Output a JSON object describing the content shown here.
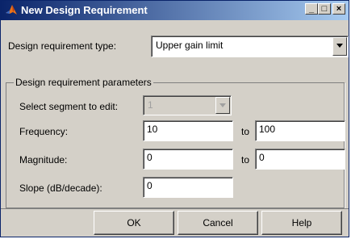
{
  "window": {
    "title": "New Design Requirement"
  },
  "titlebar_buttons": {
    "minimize": "_",
    "maximize": "□",
    "close": "×"
  },
  "type_row": {
    "label": "Design requirement type:",
    "selected": "Upper gain limit"
  },
  "params": {
    "group_title": "Design requirement parameters",
    "segment": {
      "label": "Select segment to edit:",
      "selected": "1",
      "enabled": false
    },
    "frequency": {
      "label": "Frequency:",
      "from": "10",
      "to_label": "to",
      "to": "100"
    },
    "magnitude": {
      "label": "Magnitude:",
      "from": "0",
      "to_label": "to",
      "to": "0"
    },
    "slope": {
      "label": "Slope (dB/decade):",
      "value": "0"
    }
  },
  "buttons": {
    "ok": "OK",
    "cancel": "Cancel",
    "help": "Help"
  },
  "colors": {
    "title_start": "#0a246a",
    "title_end": "#a6caf0",
    "face": "#d4d0c8"
  }
}
